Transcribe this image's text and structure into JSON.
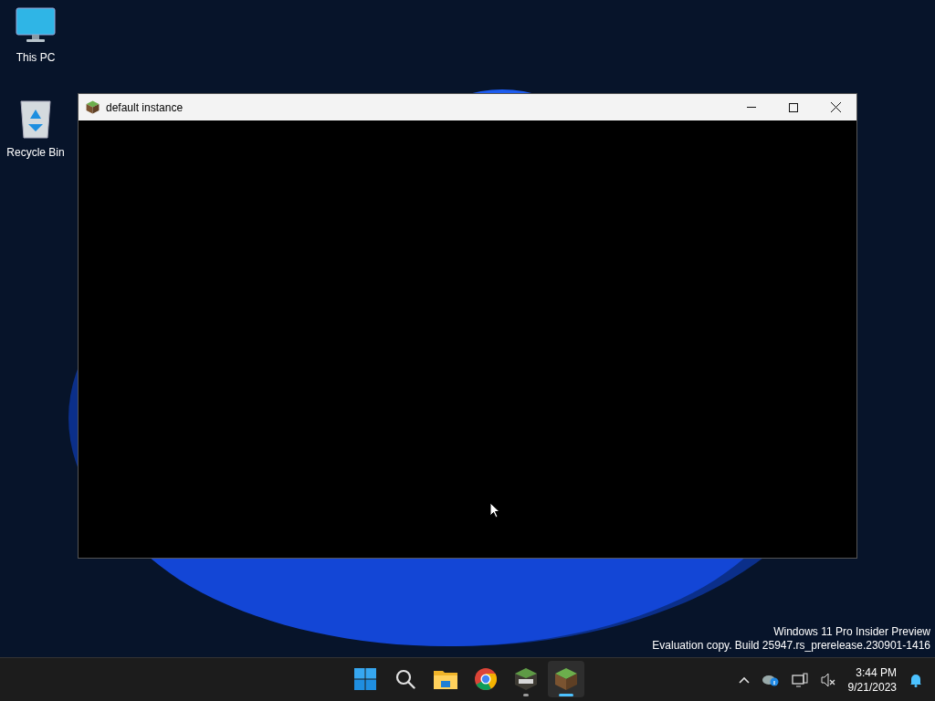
{
  "desktop_icons": [
    {
      "kind": "pc",
      "label": "This PC"
    },
    {
      "kind": "bin",
      "label": "Recycle Bin"
    }
  ],
  "window": {
    "title": "default instance"
  },
  "edition_notice": [
    "Windows 11 Pro Insider Preview",
    "Evaluation copy. Build 25947.rs_prerelease.230901-1416"
  ],
  "taskbar": {
    "apps": [
      {
        "kind": "start",
        "running": false,
        "selected": false
      },
      {
        "kind": "search",
        "running": false,
        "selected": false
      },
      {
        "kind": "folder",
        "running": false,
        "selected": false
      },
      {
        "kind": "chrome",
        "running": false,
        "selected": false
      },
      {
        "kind": "launcher",
        "running": true,
        "selected": false
      },
      {
        "kind": "block",
        "running": true,
        "selected": true
      }
    ],
    "clock": {
      "time": "3:44 PM",
      "date": "9/21/2023"
    }
  }
}
